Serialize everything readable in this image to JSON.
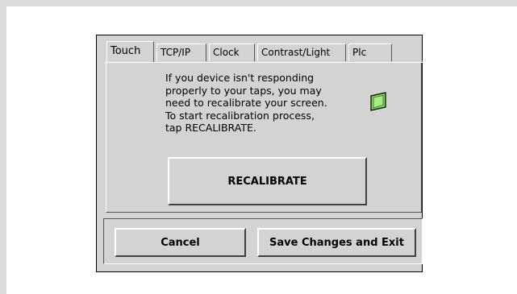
{
  "tabs": [
    {
      "label": "Touch",
      "active": true
    },
    {
      "label": "TCP/IP",
      "active": false
    },
    {
      "label": "Clock",
      "active": false
    },
    {
      "label": "Contrast/Light",
      "active": false
    },
    {
      "label": "Plc",
      "active": false
    }
  ],
  "touch": {
    "info_text": "If you device isn't responding\nproperly to your taps, you may\nneed to recalibrate your screen.\nTo start recalibration process,\ntap RECALIBRATE.",
    "icon": "screen-icon",
    "recalibrate_label": "RECALIBRATE"
  },
  "footer": {
    "cancel_label": "Cancel",
    "save_label": "Save Changes and Exit"
  },
  "colors": {
    "dialog_background": "#d3d3d3",
    "icon_green": "#7ed957",
    "frame": "#dcdcdc"
  }
}
